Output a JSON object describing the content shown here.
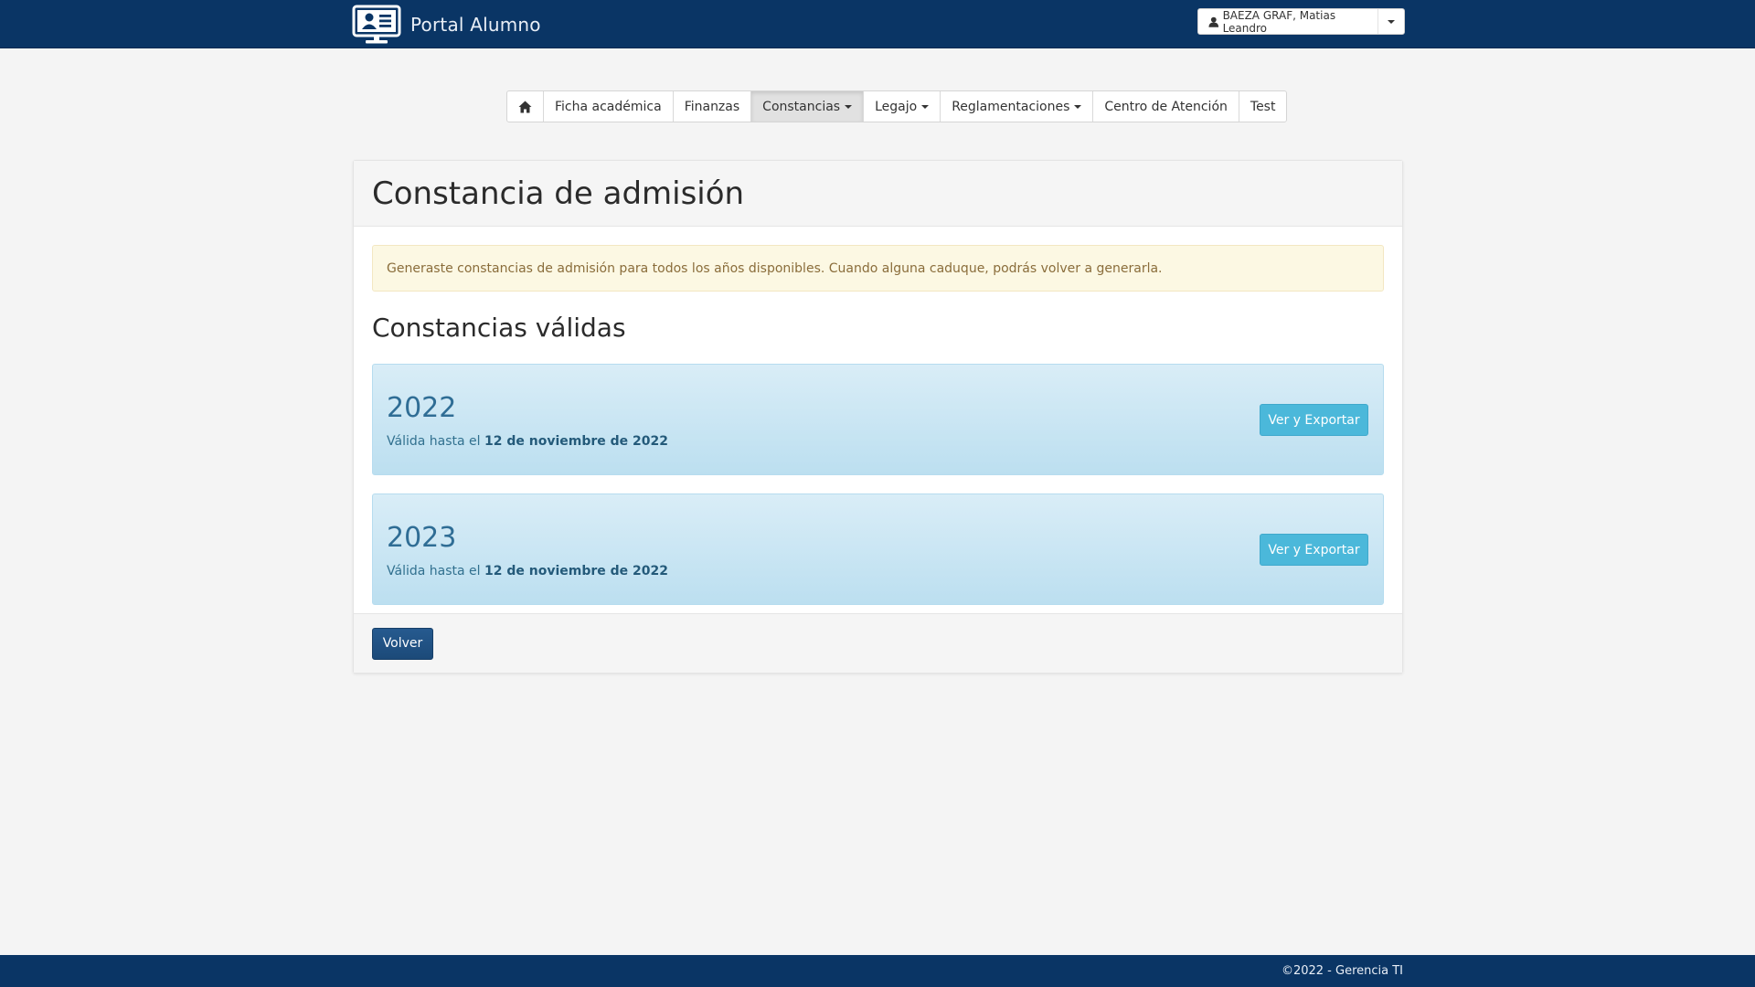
{
  "header": {
    "brand_title": "Portal Alumno",
    "brand_icon": "monitor-user-icon",
    "user_name": "BAEZA GRAF, Matias Leandro",
    "user_icon": "user-icon"
  },
  "nav": {
    "home_icon": "home-icon",
    "items": [
      {
        "label": "Ficha académica",
        "dropdown": false
      },
      {
        "label": "Finanzas",
        "dropdown": false
      },
      {
        "label": "Constancias",
        "dropdown": true,
        "active": true
      },
      {
        "label": "Legajo",
        "dropdown": true
      },
      {
        "label": "Reglamentaciones",
        "dropdown": true
      },
      {
        "label": "Centro de Atención",
        "dropdown": false
      },
      {
        "label": "Test",
        "dropdown": false
      }
    ]
  },
  "panel": {
    "title": "Constancia de admisión",
    "alert": "Generaste constancias de admisión para todos los años disponibles. Cuando alguna caduque, podrás volver a generarla.",
    "section_title": "Constancias válidas",
    "certificates": [
      {
        "year": "2022",
        "valid_prefix": "Válida hasta el",
        "valid_date": "12 de noviembre de 2022",
        "button": "Ver y Exportar"
      },
      {
        "year": "2023",
        "valid_prefix": "Válida hasta el",
        "valid_date": "12 de noviembre de 2022",
        "button": "Ver y Exportar"
      }
    ],
    "back_button": "Volver"
  },
  "footer": {
    "text": "©2022 - Gerencia TI"
  },
  "colors": {
    "brand": "#0a3565",
    "alert_bg": "#fcf8e3",
    "info_bg": "#d9edf7",
    "info_button": "#4bb8da",
    "primary_button": "#1c4a79"
  }
}
